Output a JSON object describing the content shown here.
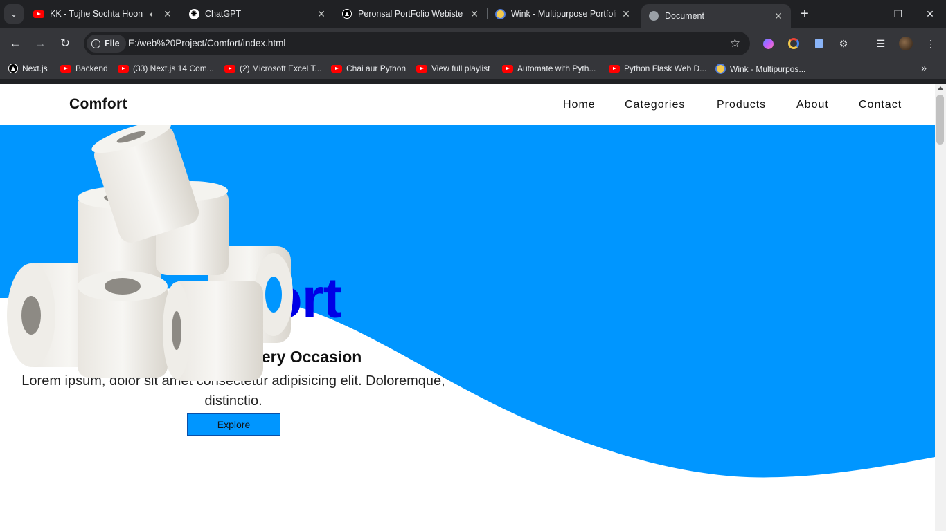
{
  "browser": {
    "tabs": [
      {
        "title": "KK - Tujhe Sochta Hoon",
        "icon": "youtube-icon",
        "audio": true
      },
      {
        "title": "ChatGPT",
        "icon": "chatgpt-icon"
      },
      {
        "title": "Peronsal PortFolio Webiste",
        "icon": "triangle-icon"
      },
      {
        "title": "Wink - Multipurpose Portfoli",
        "icon": "wink-icon"
      },
      {
        "title": "Document",
        "icon": "globe-icon",
        "active": true
      }
    ],
    "omnibox": {
      "chip": "File",
      "url": "E:/web%20Project/Comfort/index.html"
    },
    "bookmarks": [
      {
        "label": "Next.js",
        "icon": "nextjs-icon"
      },
      {
        "label": "Backend",
        "icon": "youtube-icon"
      },
      {
        "label": "(33) Next.js 14 Com...",
        "icon": "youtube-icon"
      },
      {
        "label": "(2) Microsoft Excel T...",
        "icon": "youtube-icon"
      },
      {
        "label": "Chai aur Python",
        "icon": "youtube-icon"
      },
      {
        "label": "View full playlist",
        "icon": "youtube-icon"
      },
      {
        "label": "Automate with Pyth...",
        "icon": "youtube-icon"
      },
      {
        "label": "Python Flask Web D...",
        "icon": "youtube-icon"
      },
      {
        "label": "Wink - Multipurpos...",
        "icon": "wink-icon"
      }
    ]
  },
  "site": {
    "logo": "Comfort",
    "nav": [
      "Home",
      "Categories",
      "Products",
      "About",
      "Contact"
    ],
    "hero": {
      "title": "Comfort",
      "subtitle": "Pure Softness for Every Occasion",
      "text": "Lorem ipsum, dolor sit amet consectetur adipisicing elit. Doloremque, distinctio.",
      "button": "Explore"
    }
  },
  "colors": {
    "hero_blue": "#0096ff",
    "title_blue": "#0000e6",
    "browser_dark": "#202124",
    "browser_toolbar": "#35363a"
  }
}
